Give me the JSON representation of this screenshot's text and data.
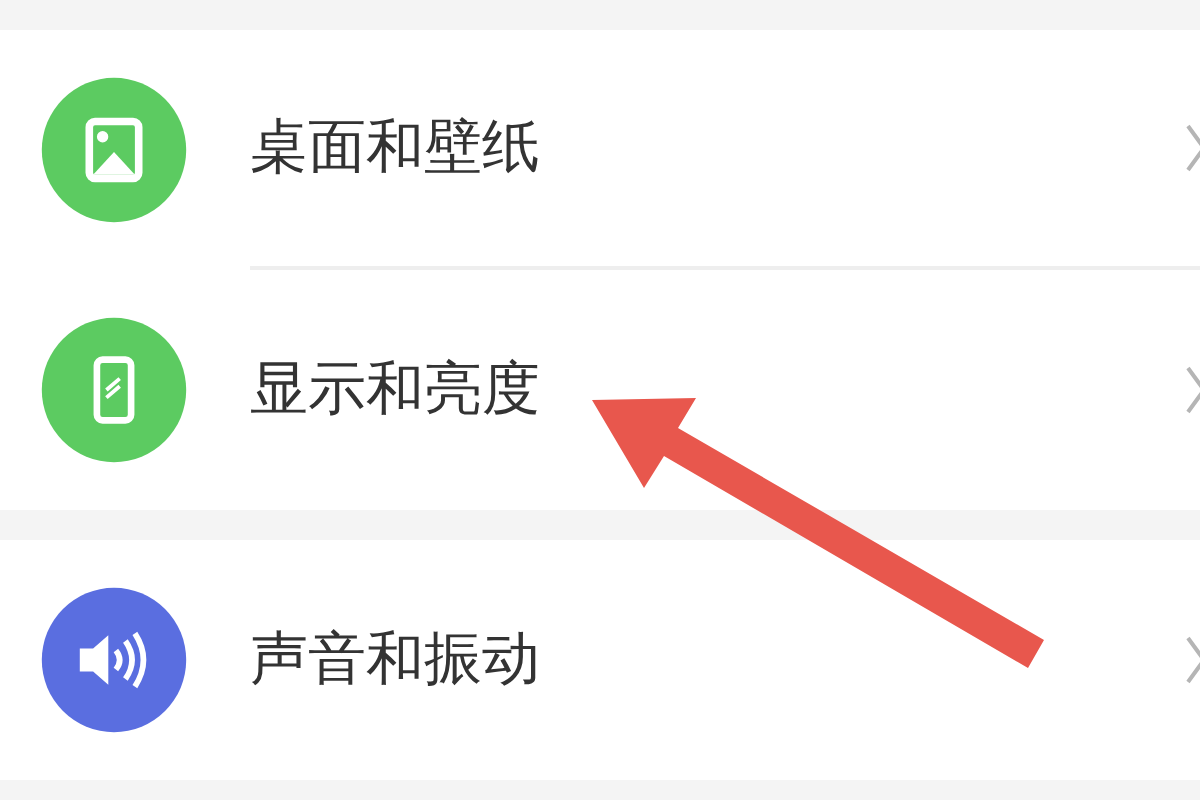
{
  "groups": [
    {
      "items": [
        {
          "label": "桌面和壁纸",
          "kind": "picture",
          "color": "#5ccb61"
        },
        {
          "label": "显示和亮度",
          "kind": "phone",
          "color": "#5ccb61"
        }
      ]
    },
    {
      "items": [
        {
          "label": "声音和振动",
          "kind": "speaker",
          "color": "#5a6ee0"
        }
      ]
    }
  ]
}
